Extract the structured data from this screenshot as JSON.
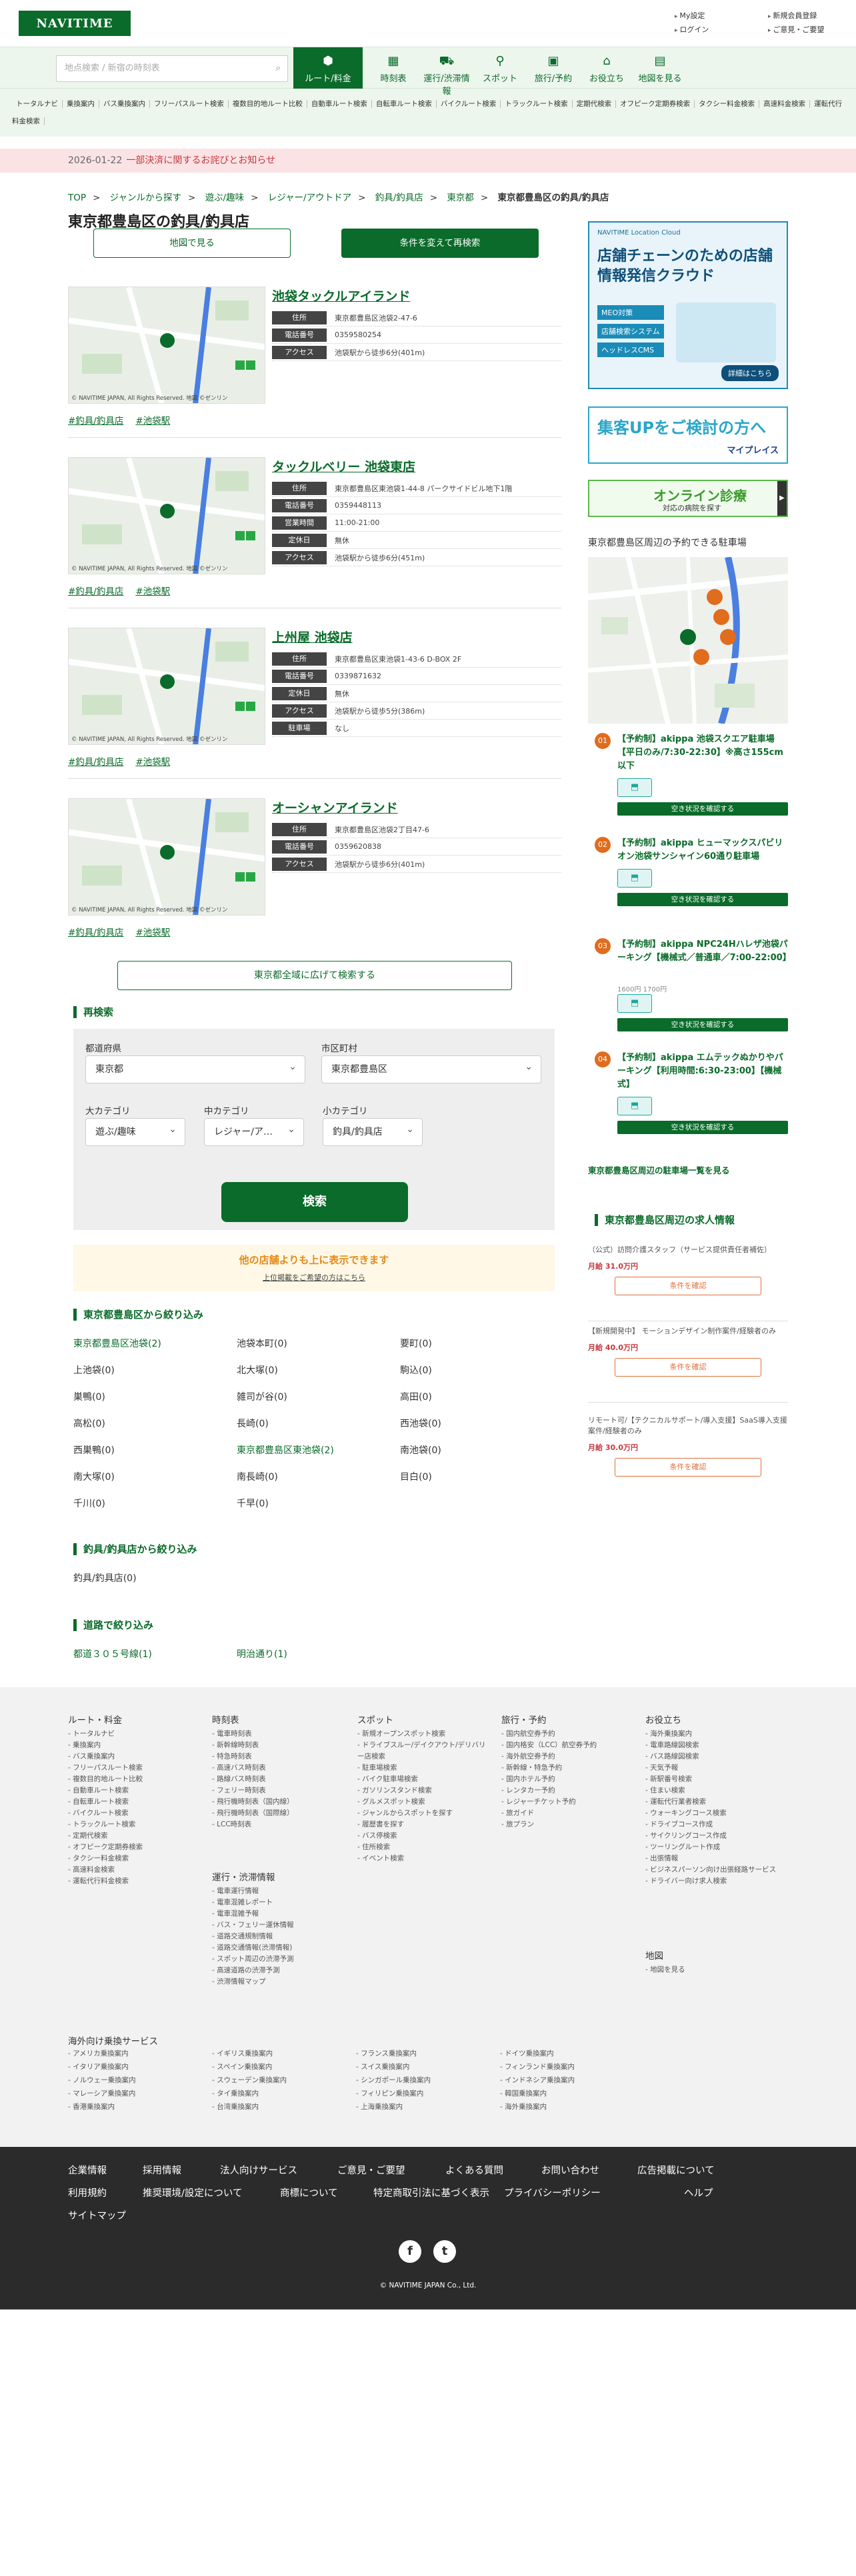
{
  "header": {
    "logo": "NAVITIME",
    "util": [
      "My設定",
      "新規会員登録",
      "ログイン",
      "ご意見・ご要望"
    ]
  },
  "nav": {
    "search_placeholder": "地点検索 / 新宿の時刻表",
    "items": [
      {
        "label": "ルート/料金",
        "icon": "route-icon"
      },
      {
        "label": "時刻表",
        "icon": "timetable-icon"
      },
      {
        "label": "運行/渋滞情報",
        "icon": "traffic-icon"
      },
      {
        "label": "スポット",
        "icon": "pin-icon"
      },
      {
        "label": "旅行/予約",
        "icon": "travel-icon"
      },
      {
        "label": "お役立ち",
        "icon": "useful-icon"
      },
      {
        "label": "地図を見る",
        "icon": "map-icon"
      }
    ]
  },
  "sublinks": [
    "トータルナビ",
    "乗換案内",
    "バス乗換案内",
    "フリーパスルート検索",
    "複数目的地ルート比較",
    "自動車ルート検索",
    "自転車ルート検索",
    "バイクルート検索",
    "トラックルート検索",
    "定期代検索",
    "オフピーク定期券検索",
    "タクシー料金検索",
    "高速料金検索",
    "運転代行料金検索"
  ],
  "notice": {
    "date": "2026-01-22",
    "text": "一部決済に関するお詫びとお知らせ"
  },
  "breadcrumb": [
    "TOP",
    "ジャンルから探す",
    "遊ぶ/趣味",
    "レジャー/アウトドア",
    "釣具/釣具店",
    "東京都",
    "東京都豊島区の釣具/釣具店"
  ],
  "page_title": "東京都豊島区の釣具/釣具店",
  "buttons": {
    "map": "地図で見る",
    "change": "条件を変えて再検索",
    "wide": "東京都全域に広げて検索する",
    "search": "検索"
  },
  "map_credit": "© NAVITIME JAPAN, All Rights Reserved. 地図 ©ゼンリン",
  "pois": [
    {
      "name": "池袋タックルアイランド",
      "rows": [
        {
          "k": "住所",
          "v": "東京都豊島区池袋2-47-6"
        },
        {
          "k": "電話番号",
          "v": "0359580254"
        },
        {
          "k": "アクセス",
          "v": "池袋駅から徒歩6分(401m)"
        }
      ]
    },
    {
      "name": "タックルベリー 池袋東店",
      "rows": [
        {
          "k": "住所",
          "v": "東京都豊島区東池袋1-44-8 パークサイドビル地下1階"
        },
        {
          "k": "電話番号",
          "v": "0359448113"
        },
        {
          "k": "営業時間",
          "v": "11:00-21:00"
        },
        {
          "k": "定休日",
          "v": "無休"
        },
        {
          "k": "アクセス",
          "v": "池袋駅から徒歩6分(451m)"
        }
      ]
    },
    {
      "name": "上州屋 池袋店",
      "rows": [
        {
          "k": "住所",
          "v": "東京都豊島区東池袋1-43-6 D-BOX 2F"
        },
        {
          "k": "電話番号",
          "v": "0339871632"
        },
        {
          "k": "定休日",
          "v": "無休"
        },
        {
          "k": "アクセス",
          "v": "池袋駅から徒歩5分(386m)"
        },
        {
          "k": "駐車場",
          "v": "なし"
        }
      ]
    },
    {
      "name": "オーシャンアイランド",
      "rows": [
        {
          "k": "住所",
          "v": "東京都豊島区池袋2丁目47-6"
        },
        {
          "k": "電話番号",
          "v": "0359620838"
        },
        {
          "k": "アクセス",
          "v": "池袋駅から徒歩6分(401m)"
        }
      ]
    }
  ],
  "tags": [
    "#釣具/釣具店",
    "#池袋駅"
  ],
  "research": {
    "title": "再検索",
    "pref_label": "都道府県",
    "pref": "東京都",
    "city_label": "市区町村",
    "city": "東京都豊島区",
    "big_label": "大カテゴリ",
    "big": "遊ぶ/趣味",
    "mid_label": "中カテゴリ",
    "mid": "レジャー/ア…",
    "small_label": "小カテゴリ",
    "small": "釣具/釣具店"
  },
  "promo": {
    "t1": "他の店舗よりも上に表示できます",
    "t2": "上位掲載をご希望の方はこちら"
  },
  "area": {
    "title": "東京都豊島区から絞り込み",
    "items": [
      "東京都豊島区池袋(2)",
      "池袋本町(0)",
      "要町(0)",
      "上池袋(0)",
      "北大塚(0)",
      "駒込(0)",
      "巣鴨(0)",
      "雑司が谷(0)",
      "高田(0)",
      "高松(0)",
      "長崎(0)",
      "西池袋(0)",
      "西巣鴨(0)",
      "東京都豊島区東池袋(2)",
      "南池袋(0)",
      "南大塚(0)",
      "南長崎(0)",
      "目白(0)",
      "千川(0)",
      "千早(0)"
    ]
  },
  "genre": {
    "title": "釣具/釣具店から絞り込み",
    "items": [
      "釣具/釣具店(0)"
    ]
  },
  "road": {
    "title": "道路で絞り込み",
    "items": [
      "都道３０５号線(1)",
      "明治通り(1)"
    ]
  },
  "ads": {
    "a1_title": "店舗チェーンのための店舗情報発信クラウド",
    "a1_brand": "NAVITIME Location Cloud",
    "a1_tags": [
      "MEO対策",
      "店舗検索システム",
      "ヘッドレスCMS"
    ],
    "a1_btn": "詳細はこちら",
    "a2_text": "集客UPをご検討の方へ",
    "a2_brand": "マイプレイス",
    "a3_text": "オンライン診療",
    "a3_sub": "対応の病院を探す"
  },
  "parking": {
    "title": "東京都豊島区周辺の予約できる駐車場",
    "items": [
      {
        "no": "01",
        "name": "【予約制】akippa 池袋スクエア駐車場【平日のみ/7:30-22:30】※高さ155cm以下",
        "btn": "空き状況を確認する",
        "price": ""
      },
      {
        "no": "02",
        "name": "【予約制】akippa ヒューマックスパビリオン池袋サンシャイン60通り駐車場",
        "btn": "空き状況を確認する",
        "price": ""
      },
      {
        "no": "03",
        "name": "【予約制】akippa NPC24Hハレザ池袋パーキング【機械式／普通車／7:00-22:00】",
        "btn": "空き状況を確認する",
        "price": "1600円 1700円"
      },
      {
        "no": "04",
        "name": "【予約制】akippa エムテックぬかりやパーキング【利用時間:6:30-23:00】【機械式】",
        "btn": "空き状況を確認する",
        "price": ""
      }
    ],
    "more": "東京都豊島区周辺の駐車場一覧を見る"
  },
  "jobs": {
    "title": "東京都豊島区周辺の求人情報",
    "btn": "条件を確認",
    "items": [
      {
        "d": "（公式）訪問介護スタッフ（サービス提供責任者補佐）",
        "s": "月給 31.0万円"
      },
      {
        "d": "【新規開発中】 モーションデザイン制作案件/経験者のみ",
        "s": "月給 40.0万円"
      },
      {
        "d": "リモート可/【テクニカルサポート/導入支援】SaaS導入支援案件/経験者のみ",
        "s": "月給 30.0万円"
      }
    ]
  },
  "footer": {
    "cols": [
      {
        "h": "ルート・料金",
        "items": [
          "トータルナビ",
          "乗換案内",
          "バス乗換案内",
          "フリーパスルート検索",
          "複数目的地ルート比較",
          "自動車ルート検索",
          "自転車ルート検索",
          "バイクルート検索",
          "トラックルート検索",
          "定期代検索",
          "オフピーク定期券検索",
          "タクシー料金検索",
          "高速料金検索",
          "運転代行料金検索"
        ]
      },
      {
        "h": "時刻表",
        "items": [
          "電車時刻表",
          "新幹線時刻表",
          "特急時刻表",
          "高速バス時刻表",
          "路線バス時刻表",
          "フェリー時刻表",
          "飛行機時刻表（国内線）",
          "飛行機時刻表（国際線）",
          "LCC時刻表"
        ]
      },
      {
        "h": "運行・渋滞情報",
        "items": [
          "電車運行情報",
          "電車混雑レポート",
          "電車混雑予報",
          "バス・フェリー運休情報",
          "道路交通規制情報",
          "道路交通情報(渋滞情報)",
          "スポット周辺の渋滞予測",
          "高速道路の渋滞予測",
          "渋滞情報マップ"
        ]
      },
      {
        "h": "スポット",
        "items": [
          "新規オープンスポット検索",
          "ドライブスルー/デイクアウト/デリバリー店検索",
          "駐車場検索",
          "バイク駐車場検索",
          "ガソリンスタンド検索",
          "グルメスポット検索",
          "ジャンルからスポットを探す",
          "履歴書を探す",
          "バス停検索",
          "住所検索",
          "イベント検索"
        ]
      },
      {
        "h": "旅行・予約",
        "items": [
          "国内航空券予約",
          "国内格安（LCC）航空券予約",
          "海外航空券予約",
          "新幹線・特急予約",
          "国内ホテル予約",
          "レンタカー予約",
          "レジャーチケット予約",
          "旅ガイド",
          "旅プラン"
        ]
      },
      {
        "h": "お役立ち",
        "items": [
          "海外乗換案内",
          "電車路線図検索",
          "バス路線図検索",
          "天気予報",
          "新駅番号検索",
          "住まい検索",
          "運転代行業者検索",
          "ウォーキングコース検索",
          "ドライブコース作成",
          "サイクリングコース作成",
          "ツーリングルート作成",
          "出張情報",
          "ビジネスパーソン向け出張経路サービス",
          "ドライバー向け求人検索"
        ]
      },
      {
        "h": "地図",
        "items": [
          "地図を見る"
        ]
      }
    ],
    "overseas": {
      "h": "海外向け乗換サービス",
      "items": [
        "アメリカ乗換案内",
        "イギリス乗換案内",
        "フランス乗換案内",
        "ドイツ乗換案内",
        "イタリア乗換案内",
        "スペイン乗換案内",
        "スイス乗換案内",
        "フィンランド乗換案内",
        "ノルウェー乗換案内",
        "スウェーデン乗換案内",
        "シンガポール乗換案内",
        "インドネシア乗換案内",
        "マレーシア乗換案内",
        "タイ乗換案内",
        "フィリピン乗換案内",
        "韓国乗換案内",
        "香港乗換案内",
        "台湾乗換案内",
        "上海乗換案内",
        "海外乗換案内"
      ]
    },
    "links": [
      "企業情報",
      "採用情報",
      "法人向けサービス",
      "ご意見・ご要望",
      "よくある質問",
      "お問い合わせ",
      "広告掲載について",
      "利用規約",
      "推奨環境/設定について",
      "商標について",
      "特定商取引法に基づく表示",
      "プライバシーポリシー",
      "ヘルプ",
      "サイトマップ"
    ],
    "copyright": "© NAVITIME JAPAN Co., Ltd."
  }
}
